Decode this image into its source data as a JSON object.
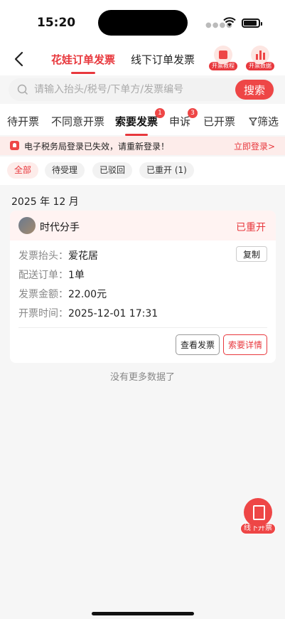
{
  "status_bar": {
    "time": "15:20"
  },
  "header": {
    "tab_active": "花娃订单发票",
    "tab_other": "线下订单发票",
    "tutorial_label": "开票教程",
    "data_label": "开票数据"
  },
  "search": {
    "placeholder": "请输入抬头/税号/下单方/发票编号",
    "button": "搜索"
  },
  "status_tabs": [
    {
      "label": "待开票"
    },
    {
      "label": "不同意开票"
    },
    {
      "label": "索要发票",
      "badge": "1"
    },
    {
      "label": "申诉",
      "badge": "3"
    },
    {
      "label": "已开票"
    },
    {
      "label": "筛选"
    }
  ],
  "notice": {
    "message": "电子税务局登录已失效，请重新登录！",
    "link": "立即登录>"
  },
  "filter_chips": [
    "全部",
    "待受理",
    "已驳回",
    "已重开 (1)"
  ],
  "month_header": "2025 年 12 月",
  "card": {
    "shop_name": "时代分手",
    "status": "已重开",
    "title_label": "发票抬头：",
    "title_value": "爱花居",
    "copy_label": "复制",
    "order_label": "配送订单：",
    "order_value": "1单",
    "amount_label": "发票金额：",
    "amount_value": "22.00元",
    "time_label": "开票时间：",
    "time_value": "2025-12-01 17:31",
    "view_button": "查看发票",
    "detail_button": "索要详情"
  },
  "no_more": "没有更多数据了",
  "fab_label": "线下开票",
  "colors": {
    "accent": "#e8383d",
    "notice_bg": "#fdecea"
  }
}
